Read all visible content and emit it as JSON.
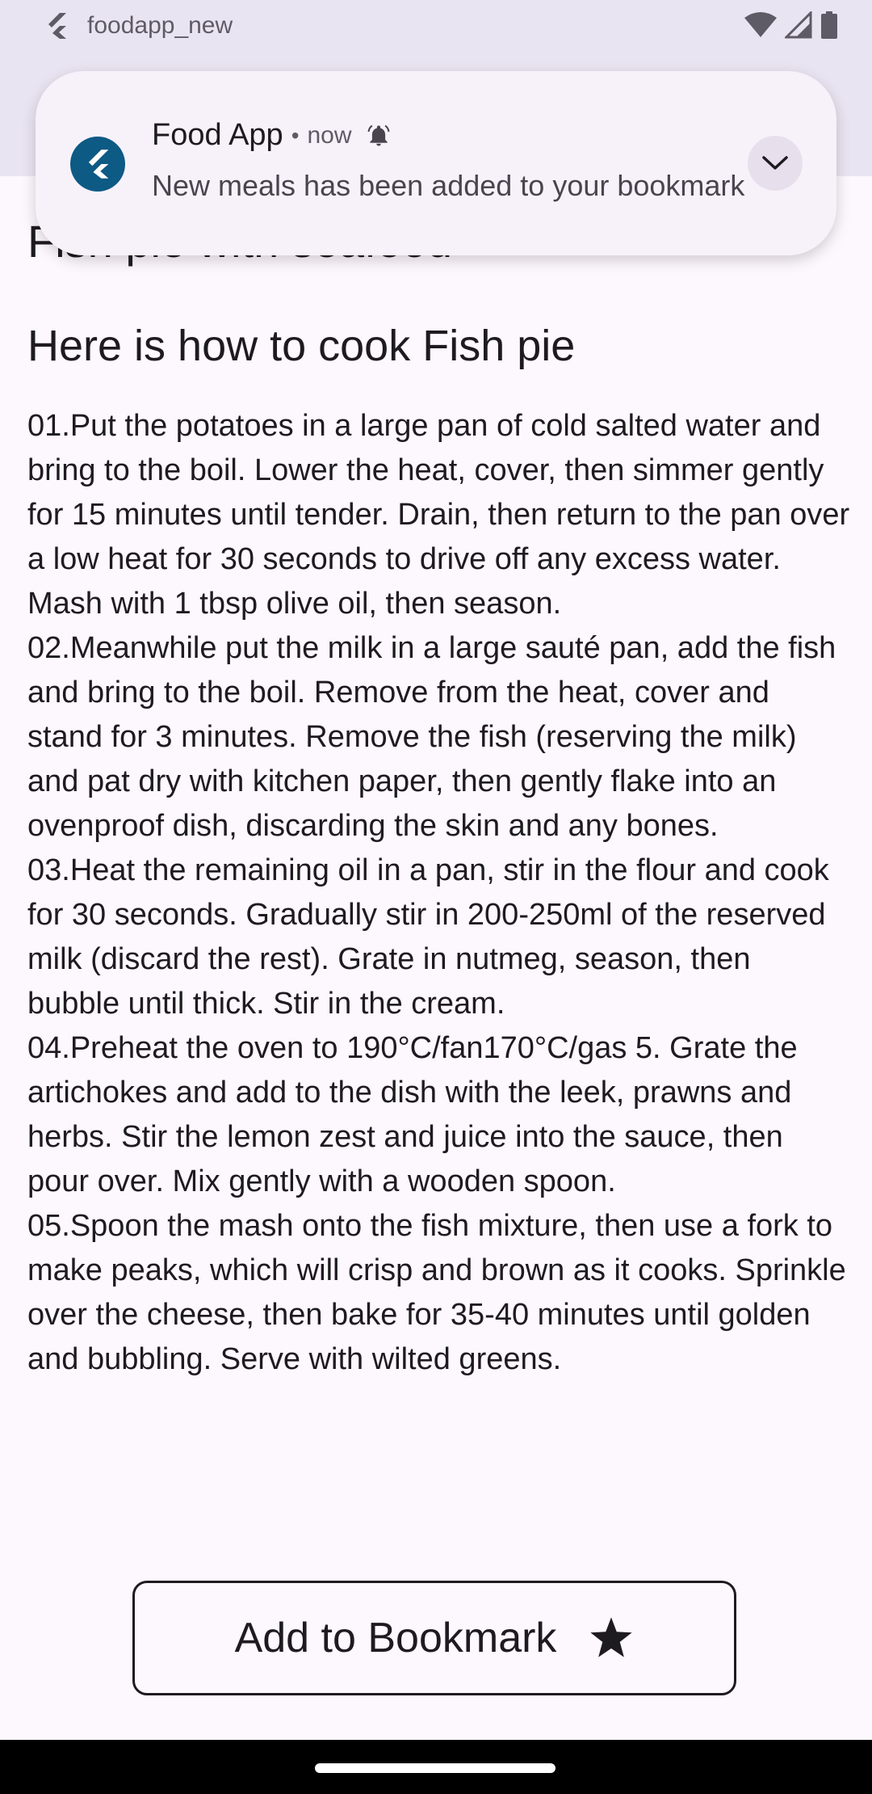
{
  "status_bar": {
    "app_name": "foodapp_new",
    "icons": [
      "flutter-logo-icon",
      "wifi-icon",
      "signal-icon",
      "battery-icon"
    ]
  },
  "notification": {
    "app_name": "Food App",
    "separator": "•",
    "time": "now",
    "message": "New meals has been added to your bookmark",
    "icons": [
      "flutter-logo-icon",
      "bell-icon",
      "chevron-down-icon"
    ],
    "icon_color": "#0d5a85"
  },
  "recipe": {
    "title": "Fish pie with seafood",
    "heading": "Here is how to cook Fish pie",
    "steps": [
      "01.Put the potatoes in a large pan of cold salted water and bring to the boil. Lower the heat, cover, then simmer gently for 15 minutes until tender. Drain, then return to the pan over a low heat for 30 seconds to drive off any excess water. Mash with 1 tbsp olive oil, then season.",
      "02.Meanwhile put the milk in a large sauté pan, add the fish and bring to the boil. Remove from the heat, cover and stand for 3 minutes. Remove the fish (reserving the milk) and pat dry with kitchen paper, then gently flake into an ovenproof dish, discarding the skin and any bones.",
      "03.Heat the remaining oil in a pan, stir in the flour and cook for 30 seconds. Gradually stir in 200-250ml of the reserved milk (discard the rest). Grate in nutmeg, season, then bubble until thick. Stir in the cream.",
      "04.Preheat the oven to 190°C/fan170°C/gas 5. Grate the artichokes and add to the dish with the leek, prawns and herbs. Stir the lemon zest and juice into the sauce, then pour over. Mix gently with a wooden spoon.",
      "05.Spoon the mash onto the fish mixture, then use a fork to make peaks, which will crisp and brown as it cooks. Sprinkle over the cheese, then bake for 35-40 minutes until golden and bubbling. Serve with wilted greens."
    ]
  },
  "bookmark_button": {
    "label": "Add to Bookmark",
    "icon": "star-icon"
  },
  "colors": {
    "background": "#fdf7fe",
    "top_bar": "#e9e4f1",
    "text": "#1d1b20"
  }
}
